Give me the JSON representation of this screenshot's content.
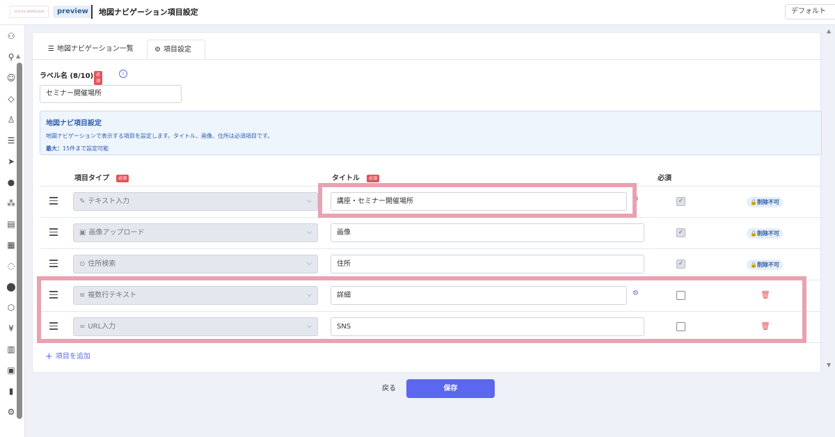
{
  "header": {
    "logo_text": "SCHOOL EMPRESSUM",
    "preview_label": "preview",
    "title": "地図ナビゲーション項目設定",
    "default_select": "デフォルト"
  },
  "tabs": [
    {
      "label": "地図ナビゲーション一覧",
      "icon": "list-icon"
    },
    {
      "label": "項目設定",
      "icon": "gear-icon"
    }
  ],
  "label_field": {
    "label": "ラベル名 (8/10)",
    "required": "必須",
    "value": "セミナー開催場所"
  },
  "info": {
    "title": "地図ナビ項目設定",
    "description": "地図ナビゲーションで表示する項目を設定します。タイトル、画像、住所は必須項目です。",
    "max_label": "最大：",
    "max_value": "15件まで設定可能"
  },
  "columns": {
    "type": "項目タイプ",
    "type_required": "必須",
    "title": "タイトル",
    "title_required": "必須",
    "required": "必須"
  },
  "rows": [
    {
      "type": "テキスト入力",
      "type_icon": "pencil-icon",
      "title": "講座・セミナー開催場所",
      "required": true,
      "locked": true,
      "lock_label": "削除不可",
      "settings": true
    },
    {
      "type": "画像アップロード",
      "type_icon": "image-icon",
      "title": "画像",
      "required": true,
      "locked": true,
      "lock_label": "削除不可",
      "settings": false
    },
    {
      "type": "住所検索",
      "type_icon": "pin-icon",
      "title": "住所",
      "required": true,
      "locked": true,
      "lock_label": "削除不可",
      "settings": false
    },
    {
      "type": "複数行テキスト",
      "type_icon": "lines-icon",
      "title": "詳細",
      "required": false,
      "locked": false,
      "settings": true
    },
    {
      "type": "URL入力",
      "type_icon": "link-icon",
      "title": "SNS",
      "required": false,
      "locked": false,
      "settings": false
    }
  ],
  "add_item": "項目を追加",
  "buttons": {
    "back": "戻る",
    "save": "保存"
  }
}
